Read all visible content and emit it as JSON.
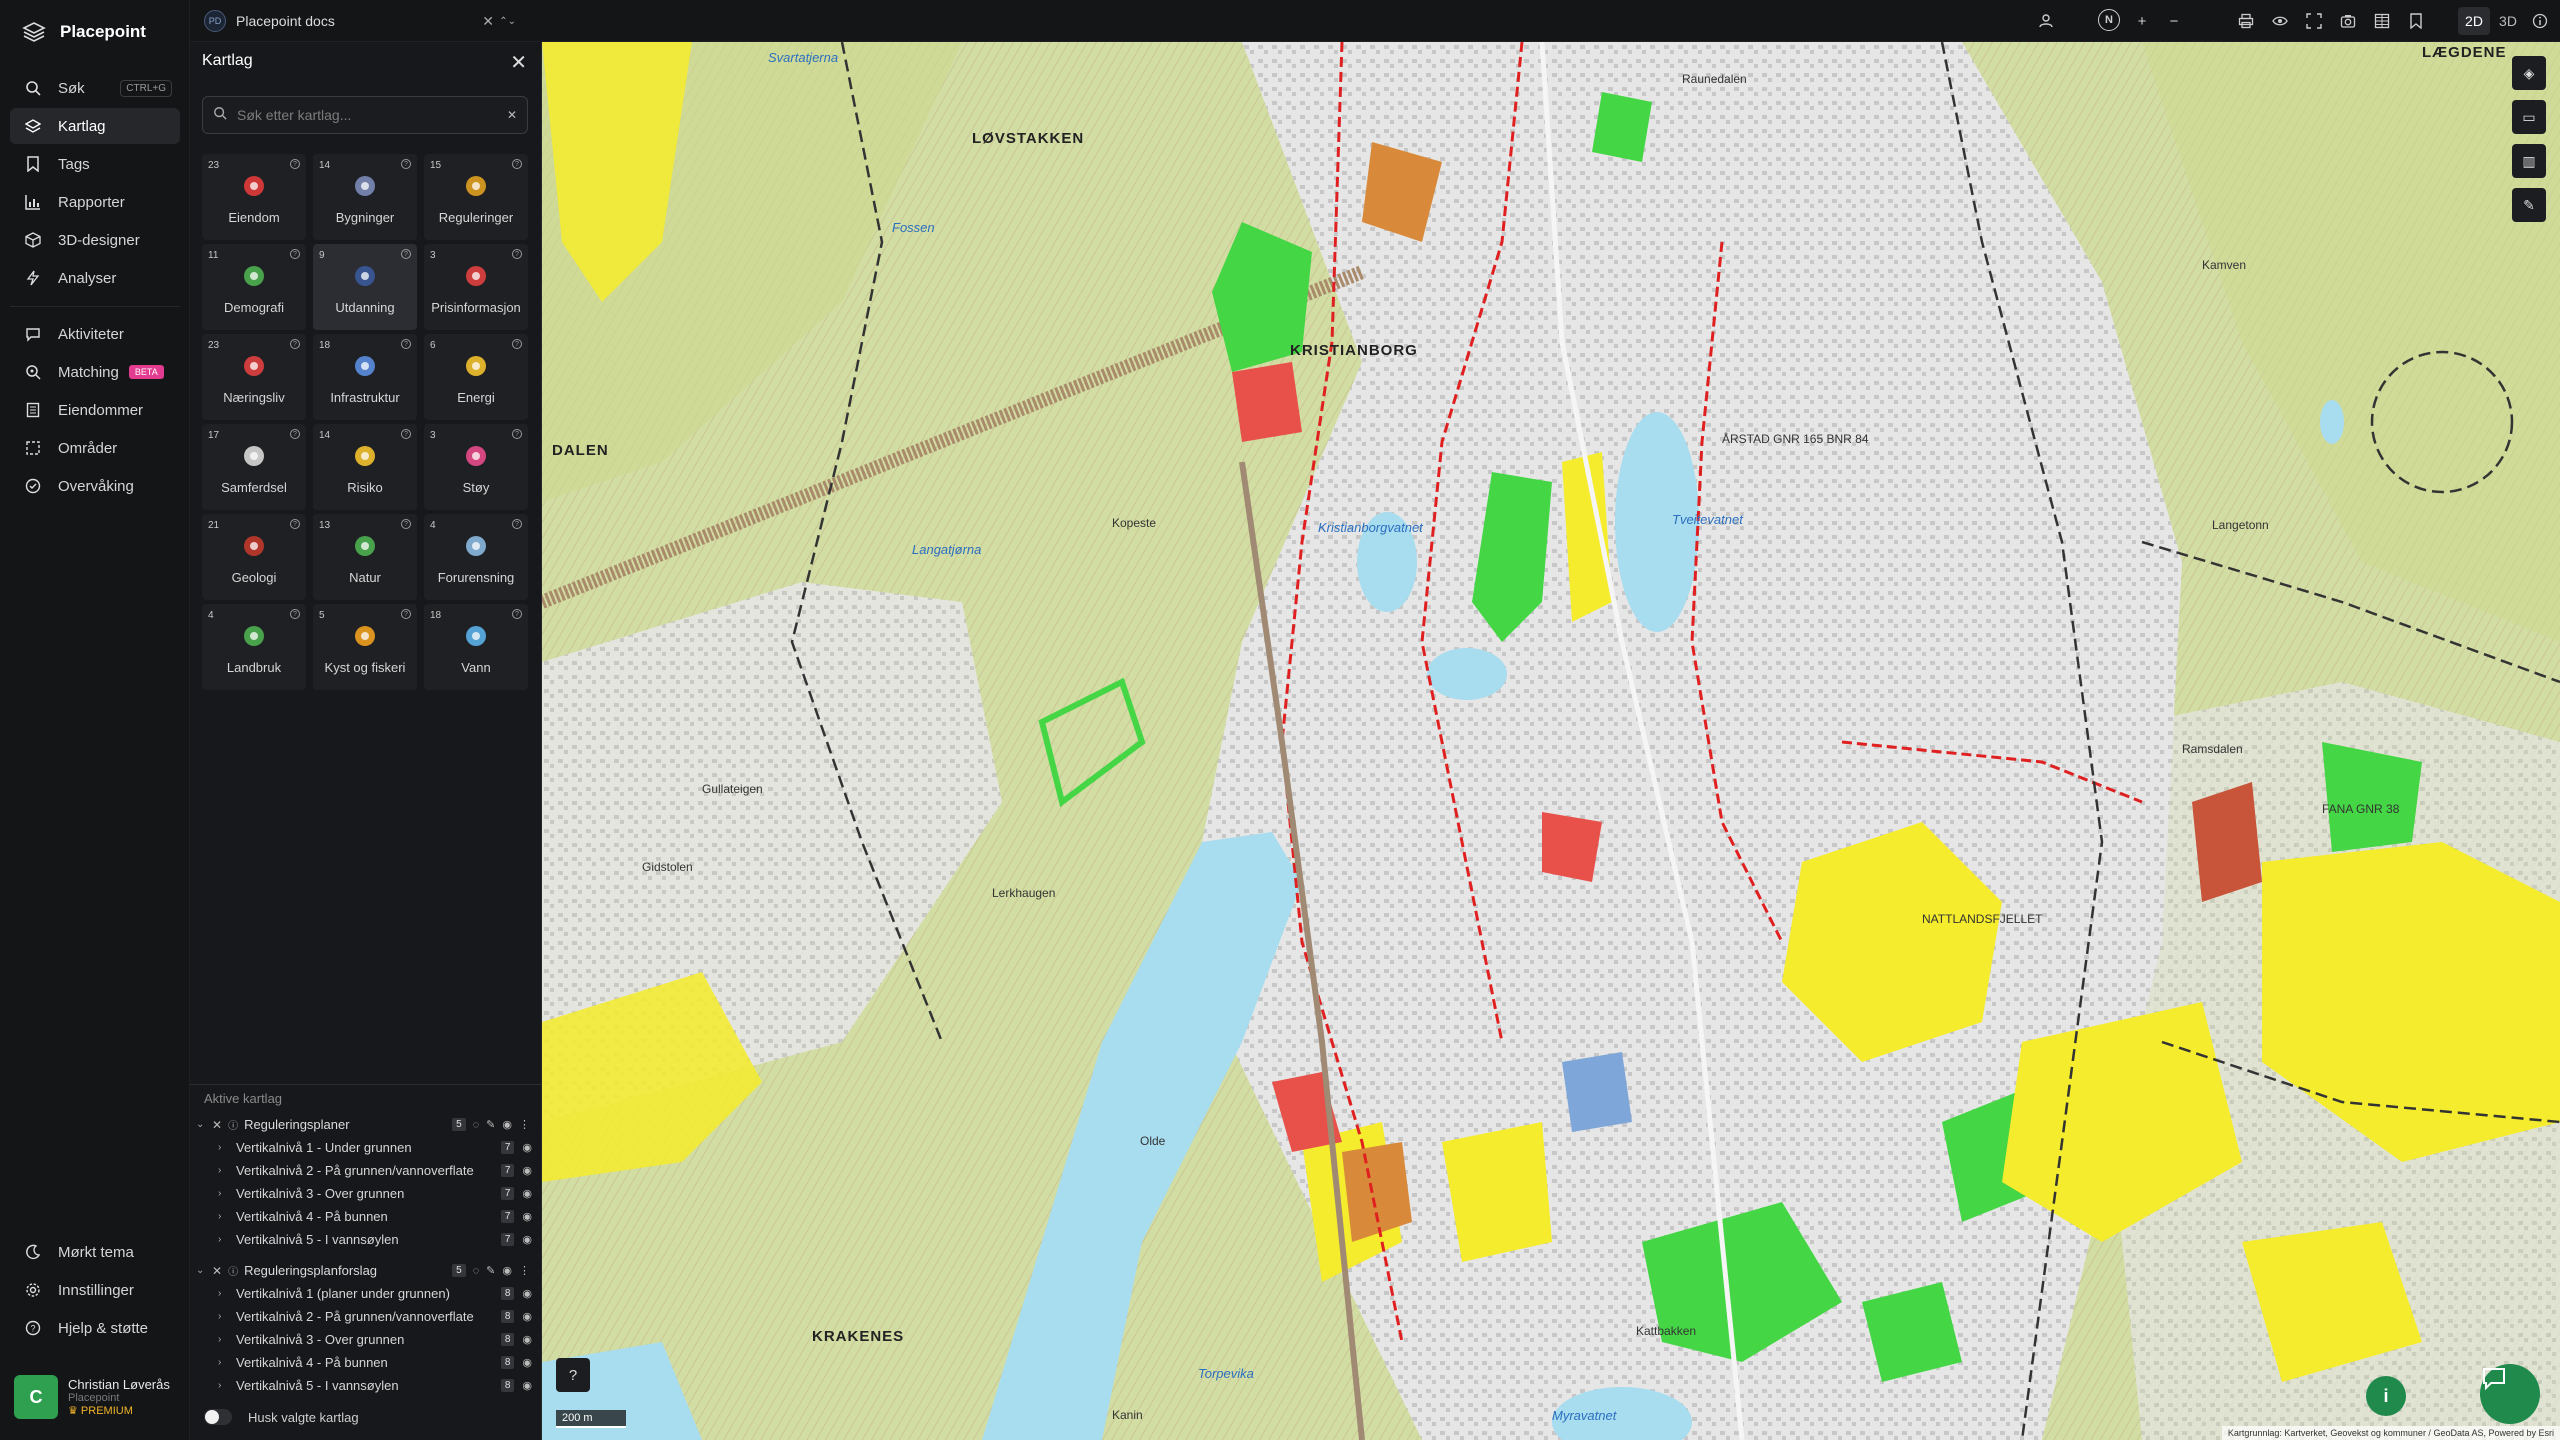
{
  "app": {
    "name": "Placepoint"
  },
  "nav": {
    "items": [
      {
        "label": "Søk",
        "icon": "search-icon",
        "shortcut": "CTRL+G"
      },
      {
        "label": "Kartlag",
        "icon": "layers-icon",
        "active": true
      },
      {
        "label": "Tags",
        "icon": "bookmark-icon"
      },
      {
        "label": "Rapporter",
        "icon": "chart-icon"
      },
      {
        "label": "3D-designer",
        "icon": "cube-icon"
      },
      {
        "label": "Analyser",
        "icon": "bolt-icon"
      }
    ],
    "items2": [
      {
        "label": "Aktiviteter",
        "icon": "chat-icon"
      },
      {
        "label": "Matching",
        "icon": "match-icon",
        "badge": "BETA"
      },
      {
        "label": "Eiendommer",
        "icon": "building-icon"
      },
      {
        "label": "Områder",
        "icon": "area-icon"
      },
      {
        "label": "Overvåking",
        "icon": "watch-icon"
      }
    ],
    "bottom": [
      {
        "label": "Mørkt tema",
        "icon": "moon-icon"
      },
      {
        "label": "Innstillinger",
        "icon": "gear-icon"
      },
      {
        "label": "Hjelp & støtte",
        "icon": "help-icon"
      }
    ],
    "user": {
      "initial": "C",
      "name": "Christian Løverås",
      "org": "Placepoint",
      "plan": "PREMIUM"
    }
  },
  "topbar": {
    "workspace_badge": "PD",
    "workspace_name": "Placepoint docs",
    "compass": "N",
    "mode_2d": "2D",
    "mode_3d": "3D"
  },
  "panel": {
    "title": "Kartlag",
    "search_placeholder": "Søk etter kartlag...",
    "categories": [
      {
        "count": "23",
        "label": "Eiendom",
        "icon": "pin-icon",
        "color": "#e23b3b"
      },
      {
        "count": "14",
        "label": "Bygninger",
        "icon": "building-icon",
        "color": "#7b8ab8"
      },
      {
        "count": "15",
        "label": "Reguleringer",
        "icon": "signpost-icon",
        "color": "#e0a020"
      },
      {
        "count": "11",
        "label": "Demografi",
        "icon": "people-icon",
        "color": "#4caf50"
      },
      {
        "count": "9",
        "label": "Utdanning",
        "icon": "graduation-icon",
        "color": "#3a5a9a",
        "selected": true
      },
      {
        "count": "3",
        "label": "Prisinformasjon",
        "icon": "shopping-bag-icon",
        "color": "#e04040"
      },
      {
        "count": "23",
        "label": "Næringsliv",
        "icon": "briefcase-icon",
        "color": "#e04040"
      },
      {
        "count": "18",
        "label": "Infrastruktur",
        "icon": "globe-icon",
        "color": "#5b8de0"
      },
      {
        "count": "6",
        "label": "Energi",
        "icon": "lightning-icon",
        "color": "#f2c12e"
      },
      {
        "count": "17",
        "label": "Samferdsel",
        "icon": "bus-icon",
        "color": "#d8d8d8"
      },
      {
        "count": "14",
        "label": "Risiko",
        "icon": "hazard-icon",
        "color": "#f2c12e"
      },
      {
        "count": "3",
        "label": "Støy",
        "icon": "noise-icon",
        "color": "#e84a8a"
      },
      {
        "count": "21",
        "label": "Geologi",
        "icon": "layers-geo-icon",
        "color": "#c0392b"
      },
      {
        "count": "13",
        "label": "Natur",
        "icon": "leaf-icon",
        "color": "#4caf50"
      },
      {
        "count": "4",
        "label": "Forurensning",
        "icon": "factory-icon",
        "color": "#8ab8e0"
      },
      {
        "count": "4",
        "label": "Landbruk",
        "icon": "sprout-icon",
        "color": "#4caf50"
      },
      {
        "count": "5",
        "label": "Kyst og fiskeri",
        "icon": "fish-icon",
        "color": "#f0a020"
      },
      {
        "count": "18",
        "label": "Vann",
        "icon": "water-drop-icon",
        "color": "#5bb0e8"
      }
    ],
    "active_title": "Aktive kartlag",
    "groups": [
      {
        "name": "Reguleringsplaner",
        "count": "5",
        "rows": [
          {
            "label": "Vertikalnivå 1 - Under grunnen",
            "count": "7"
          },
          {
            "label": "Vertikalnivå 2 - På grunnen/vannoverflate",
            "count": "7"
          },
          {
            "label": "Vertikalnivå 3 - Over grunnen",
            "count": "7"
          },
          {
            "label": "Vertikalnivå 4 - På bunnen",
            "count": "7"
          },
          {
            "label": "Vertikalnivå 5 - I vannsøylen",
            "count": "7"
          }
        ]
      },
      {
        "name": "Reguleringsplanforslag",
        "count": "5",
        "rows": [
          {
            "label": "Vertikalnivå 1 (planer under grunnen)",
            "count": "8"
          },
          {
            "label": "Vertikalnivå 2 - På grunnen/vannoverflate",
            "count": "8"
          },
          {
            "label": "Vertikalnivå 3 - Over grunnen",
            "count": "8"
          },
          {
            "label": "Vertikalnivå 4 - På bunnen",
            "count": "8"
          },
          {
            "label": "Vertikalnivå 5 - I vannsøylen",
            "count": "8"
          }
        ]
      }
    ],
    "remember_label": "Husk valgte kartlag"
  },
  "map": {
    "labels": {
      "lovstakken": "LØVSTAKKEN",
      "kristianborg": "KRISTIANBORG",
      "dalen": "DALEN",
      "krakenes": "KRAKENES",
      "laegdene": "LÆGDENE",
      "arstad": "ÅRSTAD GNR 165 BNR 84",
      "nesttun": "NATTLANDSFJELLET",
      "fana": "FANA GNR 38",
      "kristianborgvatnet": "Kristianborgvatnet",
      "tveitevatnet": "Tveitevatnet",
      "myravatnet": "Myravatnet",
      "fossen": "Fossen",
      "svartatjerna": "Svartatjerna",
      "langatjorna": "Langatjørna",
      "kopeste": "Kopeste",
      "gullateigen": "Gullateigen",
      "gidstolen": "Gidstolen",
      "lerkhaugen": "Lerkhaugen",
      "raunedalen": "Raunedalen",
      "kamven": "Kamven",
      "langetonn": "Langetonn",
      "ramsdalen": "Ramsdalen",
      "kattbakken": "Kattbakken",
      "torpevika": "Torpevika",
      "kanin": "Kanin",
      "olde": "Olde"
    },
    "scale_label": "200 m",
    "attribution": "Kartgrunnlag: Kartverket, Geovekst og kommuner / GeoData AS, Powered by Esri",
    "colors": {
      "base": "#d8e2b0",
      "forest": "#c9d98a",
      "urban": "#e3e3e3",
      "water": "#a8dcef",
      "yellow_zone": "#f4ec2c",
      "green_zone": "#45d645",
      "red_zone": "#e8504a",
      "orange_zone": "#d88a3a",
      "blue_zone": "#7ea6d8",
      "reg_line": "#e02020",
      "plan_line": "#333333"
    }
  }
}
